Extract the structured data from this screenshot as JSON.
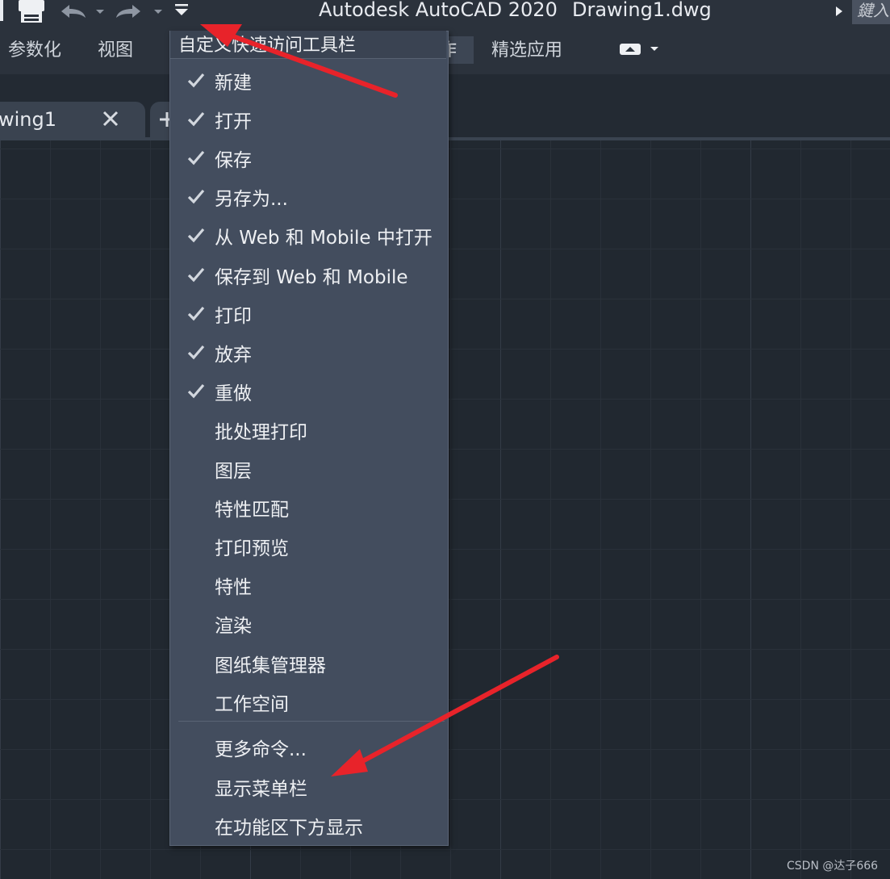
{
  "title_bar": {
    "app_title": "Autodesk AutoCAD 2020",
    "doc_title": "Drawing1.dwg",
    "search_label": "鍵入"
  },
  "ribbon": {
    "tabs": [
      "参数化",
      "视图"
    ],
    "active_tab_fragment": "作",
    "extra_tab": "精选应用"
  },
  "file_tabs": {
    "current": "wing1"
  },
  "qat_menu": {
    "header": "自定义快速访问工具栏",
    "items": [
      {
        "label": "新建",
        "checked": true
      },
      {
        "label": "打开",
        "checked": true
      },
      {
        "label": "保存",
        "checked": true
      },
      {
        "label": "另存为...",
        "checked": true
      },
      {
        "label": "从 Web 和 Mobile 中打开",
        "checked": true
      },
      {
        "label": "保存到 Web 和 Mobile",
        "checked": true
      },
      {
        "label": "打印",
        "checked": true
      },
      {
        "label": "放弃",
        "checked": true
      },
      {
        "label": "重做",
        "checked": true
      },
      {
        "label": "批处理打印",
        "checked": false
      },
      {
        "label": "图层",
        "checked": false
      },
      {
        "label": "特性匹配",
        "checked": false
      },
      {
        "label": "打印预览",
        "checked": false
      },
      {
        "label": "特性",
        "checked": false
      },
      {
        "label": "渲染",
        "checked": false
      },
      {
        "label": "图纸集管理器",
        "checked": false
      },
      {
        "label": "工作空间",
        "checked": false
      }
    ],
    "more_items": [
      {
        "label": "更多命令..."
      },
      {
        "label": "显示菜单栏"
      },
      {
        "label": "在功能区下方显示"
      }
    ]
  },
  "watermark": "CSDN @达子666",
  "colors": {
    "canvas_bg": "#212830",
    "menu_bg": "#434d5e",
    "annotation_arrow": "#e8232a"
  }
}
